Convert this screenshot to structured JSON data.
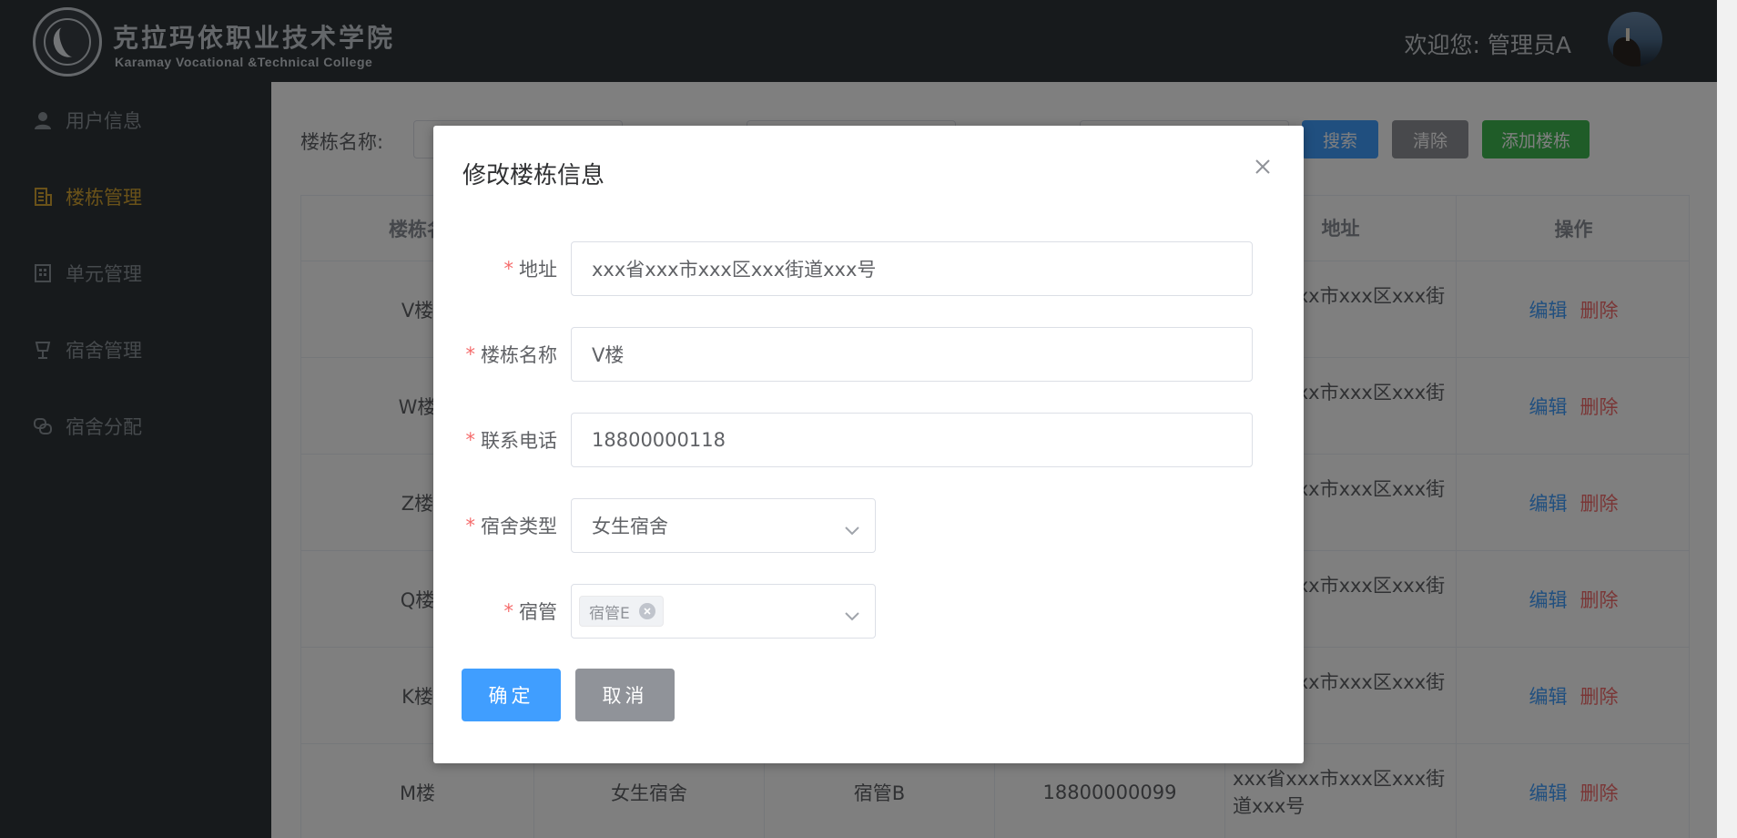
{
  "header": {
    "school_name_cn": "克拉玛依职业技术学院",
    "school_name_en": "Karamay Vocational &Technical College",
    "welcome": "欢迎您: 管理员A"
  },
  "sidebar": {
    "items": [
      {
        "label": "用户信息",
        "icon": "user-icon"
      },
      {
        "label": "楼栋管理",
        "icon": "building-icon",
        "active": true
      },
      {
        "label": "单元管理",
        "icon": "unit-icon"
      },
      {
        "label": "宿舍管理",
        "icon": "lamp-icon"
      },
      {
        "label": "宿舍分配",
        "icon": "assign-icon"
      }
    ]
  },
  "search": {
    "building_label": "楼栋名称:",
    "search_button": "搜索",
    "clear_button": "清除",
    "add_button": "添加楼栋"
  },
  "table": {
    "headers": [
      "楼栋名",
      "",
      "",
      "",
      "地址",
      "操作"
    ],
    "rows": [
      {
        "name": "V楼",
        "type": "",
        "manager": "",
        "phone": "",
        "address": "xxx省xxx市xxx区xxx街道xxx号"
      },
      {
        "name": "W楼",
        "type": "",
        "manager": "",
        "phone": "",
        "address": "xxx省xxx市xxx区xxx街道xxx号"
      },
      {
        "name": "Z楼",
        "type": "",
        "manager": "",
        "phone": "",
        "address": "xxx省xxx市xxx区xxx街道xxx号"
      },
      {
        "name": "Q楼",
        "type": "",
        "manager": "",
        "phone": "",
        "address": "xxx省xxx市xxx区xxx街道xxx号"
      },
      {
        "name": "K楼",
        "type": "",
        "manager": "",
        "phone": "",
        "address": "xxx省xxx市xxx区xxx街道xxx号"
      },
      {
        "name": "M楼",
        "type": "女生宿舍",
        "manager": "宿管B",
        "phone": "18800000099",
        "address": "xxx省xxx市xxx区xxx街道xxx号"
      }
    ],
    "edit_label": "编辑",
    "delete_label": "删除"
  },
  "dialog": {
    "title": "修改楼栋信息",
    "fields": {
      "address_label": "地址",
      "address_value": "xxx省xxx市xxx区xxx街道xxx号",
      "name_label": "楼栋名称",
      "name_value": "V楼",
      "phone_label": "联系电话",
      "phone_value": "18800000118",
      "type_label": "宿舍类型",
      "type_value": "女生宿舍",
      "manager_label": "宿管",
      "manager_tag": "宿管E"
    },
    "required_mark": "*",
    "ok_button": "确定",
    "cancel_button": "取消"
  }
}
